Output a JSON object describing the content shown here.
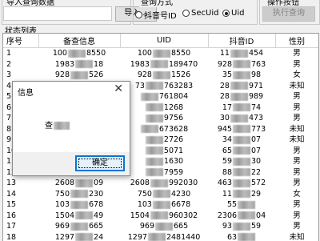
{
  "groups": {
    "import": {
      "title": "导入查询数据",
      "button": "导入..."
    },
    "method": {
      "title": "查询方式",
      "options": [
        "抖音号ID",
        "SecUid",
        "Uid"
      ],
      "selected": "Uid"
    },
    "action": {
      "title": "操作按钮",
      "button": "执行查询"
    }
  },
  "status": {
    "title": "状态列表"
  },
  "table": {
    "columns": [
      "序号",
      "备查信息",
      "UID",
      "抖音ID",
      "性别"
    ],
    "rows": [
      [
        "1",
        "100",
        "8550",
        "100",
        "8550",
        "11",
        "454",
        "男"
      ],
      [
        "2",
        "1983",
        "18",
        "1983",
        "189470",
        "928",
        "763",
        "男"
      ],
      [
        "3",
        "928",
        "526",
        "928",
        "1526",
        "35",
        "98",
        "女"
      ],
      [
        "4",
        "73",
        "49",
        "73",
        "763283",
        "28",
        "971",
        "未知"
      ],
      [
        "5",
        "",
        "",
        "",
        "761804",
        "28",
        "989",
        "男"
      ],
      [
        "6",
        "",
        "",
        "",
        "1268",
        "17",
        "74",
        "男"
      ],
      [
        "7",
        "",
        "",
        "",
        "9756",
        "30",
        "473",
        "男"
      ],
      [
        "8",
        "",
        "",
        "",
        "673628",
        "945",
        "773",
        "未知"
      ],
      [
        "9",
        "",
        "",
        "",
        "2726",
        "34",
        "07",
        "未知"
      ],
      [
        "10",
        "",
        "",
        "",
        "5071",
        "65",
        "07",
        "男"
      ],
      [
        "11",
        "",
        "",
        "",
        "1630",
        "59",
        "30",
        "男"
      ],
      [
        "12",
        "",
        "",
        "",
        "7959",
        "88",
        "22",
        "男"
      ],
      [
        "13",
        "2608",
        "09",
        "2608",
        "992030",
        "463",
        "572",
        "男"
      ],
      [
        "14",
        "750",
        "230",
        "750",
        "4230",
        "11",
        "29",
        "女"
      ],
      [
        "15",
        "103",
        "678",
        "103",
        "6678",
        "55",
        "",
        "男"
      ],
      [
        "16",
        "1504",
        "49",
        "1504",
        "960302",
        "2306",
        "04",
        "男"
      ],
      [
        "17",
        "969",
        "665",
        "969",
        "665",
        "93",
        "59",
        "男"
      ],
      [
        "18",
        "1297",
        "24",
        "1297",
        "2481440",
        "63",
        "",
        "未知"
      ]
    ]
  },
  "dialog": {
    "title": "信息",
    "message": "查",
    "ok": "确定"
  }
}
